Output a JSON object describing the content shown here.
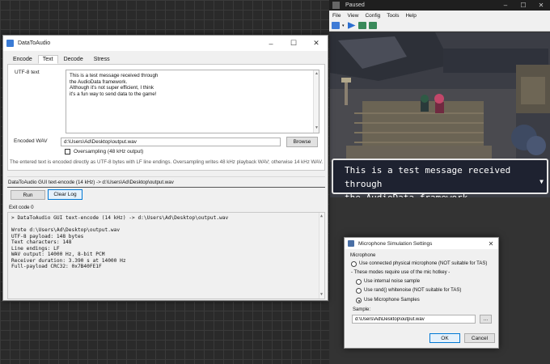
{
  "dta": {
    "title": "DataToAudio",
    "tabs": [
      "Encode",
      "Text",
      "Decode",
      "Stress"
    ],
    "active_tab": "Text",
    "utf8_label": "UTF-8 text",
    "text_lines": [
      "This is a test message received through",
      "the AudioData framework.",
      "Although it's not super efficient, I think",
      "it's a fun way to send data to the game!"
    ],
    "encoded_wav_label": "Encoded WAV",
    "wav_path": "d:\\Users\\Ad\\Desktop\\output.wav",
    "browse_label": "Browse",
    "oversampling_label": "Oversampling (48 kHz output)",
    "oversampling_checked": false,
    "note": "The entered text is encoded directly as UTF-8 bytes with LF line endings. Oversampling writes 48 kHz playback WAV; otherwise 14 kHz WAV.",
    "command_line": "DataToAudio GUI text-encode (14 kHz) -> d:\\Users\\Ad\\Desktop\\output.wav",
    "run_label": "Run",
    "clear_log_label": "Clear Log",
    "exit_code": "Exit code 0",
    "output_lines": [
      "> DataToAudio GUI text-encode (14 kHz) -> d:\\Users\\Ad\\Desktop\\output.wav",
      "",
      "Wrote d:\\Users\\Ad\\Desktop\\output.wav",
      "UTF-8 payload: 148 bytes",
      "Text characters: 148",
      "Line endings: LF",
      "WAV output: 14000 Hz, 8-bit PCM",
      "Receiver duration: 3.390 s at 14000 Hz",
      "Full-payload CRC32: 0x7B40FE1F"
    ]
  },
  "emu": {
    "title": "Paused",
    "menu": [
      "File",
      "View",
      "Config",
      "Tools",
      "Help"
    ],
    "dialog_lines": [
      "This is a test message received through",
      "the AudioData framework."
    ]
  },
  "mic": {
    "title": "Microphone Simulation Settings",
    "group_label": "Microphone",
    "opt_physical": "Use connected physical microphone (NOT suitable for TAS)",
    "hotkey_note": "- These modes require use of the mic hotkey -",
    "opt_noise": "Use internal noise sample",
    "opt_rand": "Use rand() whitenoise (NOT suitable for TAS)",
    "opt_samples": "Use Microphone Samples",
    "selected": "opt_samples",
    "sample_label": "Sample:",
    "sample_path": "d:\\Users\\Ad\\Desktop\\output.wav",
    "browse_label": "...",
    "ok_label": "OK",
    "cancel_label": "Cancel"
  }
}
